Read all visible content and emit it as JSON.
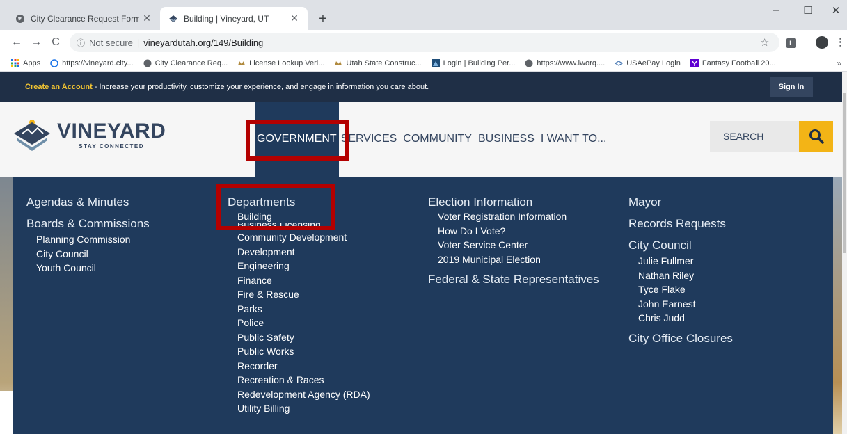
{
  "browser": {
    "tabs": [
      {
        "title": "City Clearance Request Form",
        "active": false
      },
      {
        "title": "Building | Vineyard, UT",
        "active": true
      }
    ],
    "new_tab": "+",
    "window_controls": {
      "minimize": "–",
      "maximize": "☐",
      "close": "✕"
    },
    "nav": {
      "back": "←",
      "forward": "→",
      "reload": "C"
    },
    "omnibox": {
      "security": "Not secure",
      "url": "vineyardutah.org/149/Building"
    },
    "extension_label": "L",
    "bookmarks": [
      {
        "label": "Apps",
        "icon": "apps-grid-icon"
      },
      {
        "label": "https://vineyard.city...",
        "icon": "globe-icon"
      },
      {
        "label": "City Clearance Req...",
        "icon": "globe-icon"
      },
      {
        "label": "License Lookup Veri...",
        "icon": "utah-seal-icon"
      },
      {
        "label": "Utah State Construc...",
        "icon": "utah-seal-icon"
      },
      {
        "label": "Login | Building Per...",
        "icon": "building-icon"
      },
      {
        "label": "https://www.iworq....",
        "icon": "globe-icon"
      },
      {
        "label": "USAePay Login",
        "icon": "usaepay-icon"
      },
      {
        "label": "Fantasy Football 20...",
        "icon": "yahoo-icon"
      }
    ],
    "bookmarks_more": "»"
  },
  "site": {
    "account_bar": {
      "create_link": "Create an Account",
      "message": " - Increase your productivity, customize your experience, and engage in information you care about.",
      "sign_in": "Sign In"
    },
    "logo": {
      "title": "VINEYARD",
      "tagline": "STAY CONNECTED"
    },
    "nav": [
      "GOVERNMENT",
      "SERVICES",
      "COMMUNITY",
      "BUSINESS",
      "I WANT TO..."
    ],
    "search_placeholder": "SEARCH",
    "mega_menu": {
      "col1": {
        "items": [
          {
            "label": "Agendas & Minutes",
            "children": []
          },
          {
            "label": "Boards & Commissions",
            "children": [
              "Planning Commission",
              "City Council",
              "Youth Council"
            ]
          }
        ]
      },
      "col2": {
        "heading": "Departments",
        "highlighted": "Building",
        "obscured": "Business Licensing",
        "children": [
          "Community Development",
          "Development",
          "Engineering",
          "Finance",
          "Fire & Rescue",
          "Parks",
          "Police",
          "Public Safety",
          "Public Works",
          "Recorder",
          "Recreation & Races",
          "Redevelopment Agency (RDA)",
          "Utility Billing"
        ]
      },
      "col3": {
        "heading": "Election Information",
        "children": [
          "Voter Registration Information",
          "How Do I Vote?",
          "Voter Service Center",
          "2019 Municipal Election"
        ],
        "heading2": "Federal & State Representatives"
      },
      "col4": {
        "mayor": "Mayor",
        "records": "Records Requests",
        "council": "City Council",
        "council_members": [
          "Julie Fullmer",
          "Nathan Riley",
          "Tyce Flake",
          "John Earnest",
          "Chris Judd"
        ],
        "closures": "City Office Closures"
      }
    },
    "colors": {
      "navy": "#1f3a5c",
      "accent_yellow": "#f3b416",
      "highlight_red": "#b30000"
    }
  }
}
